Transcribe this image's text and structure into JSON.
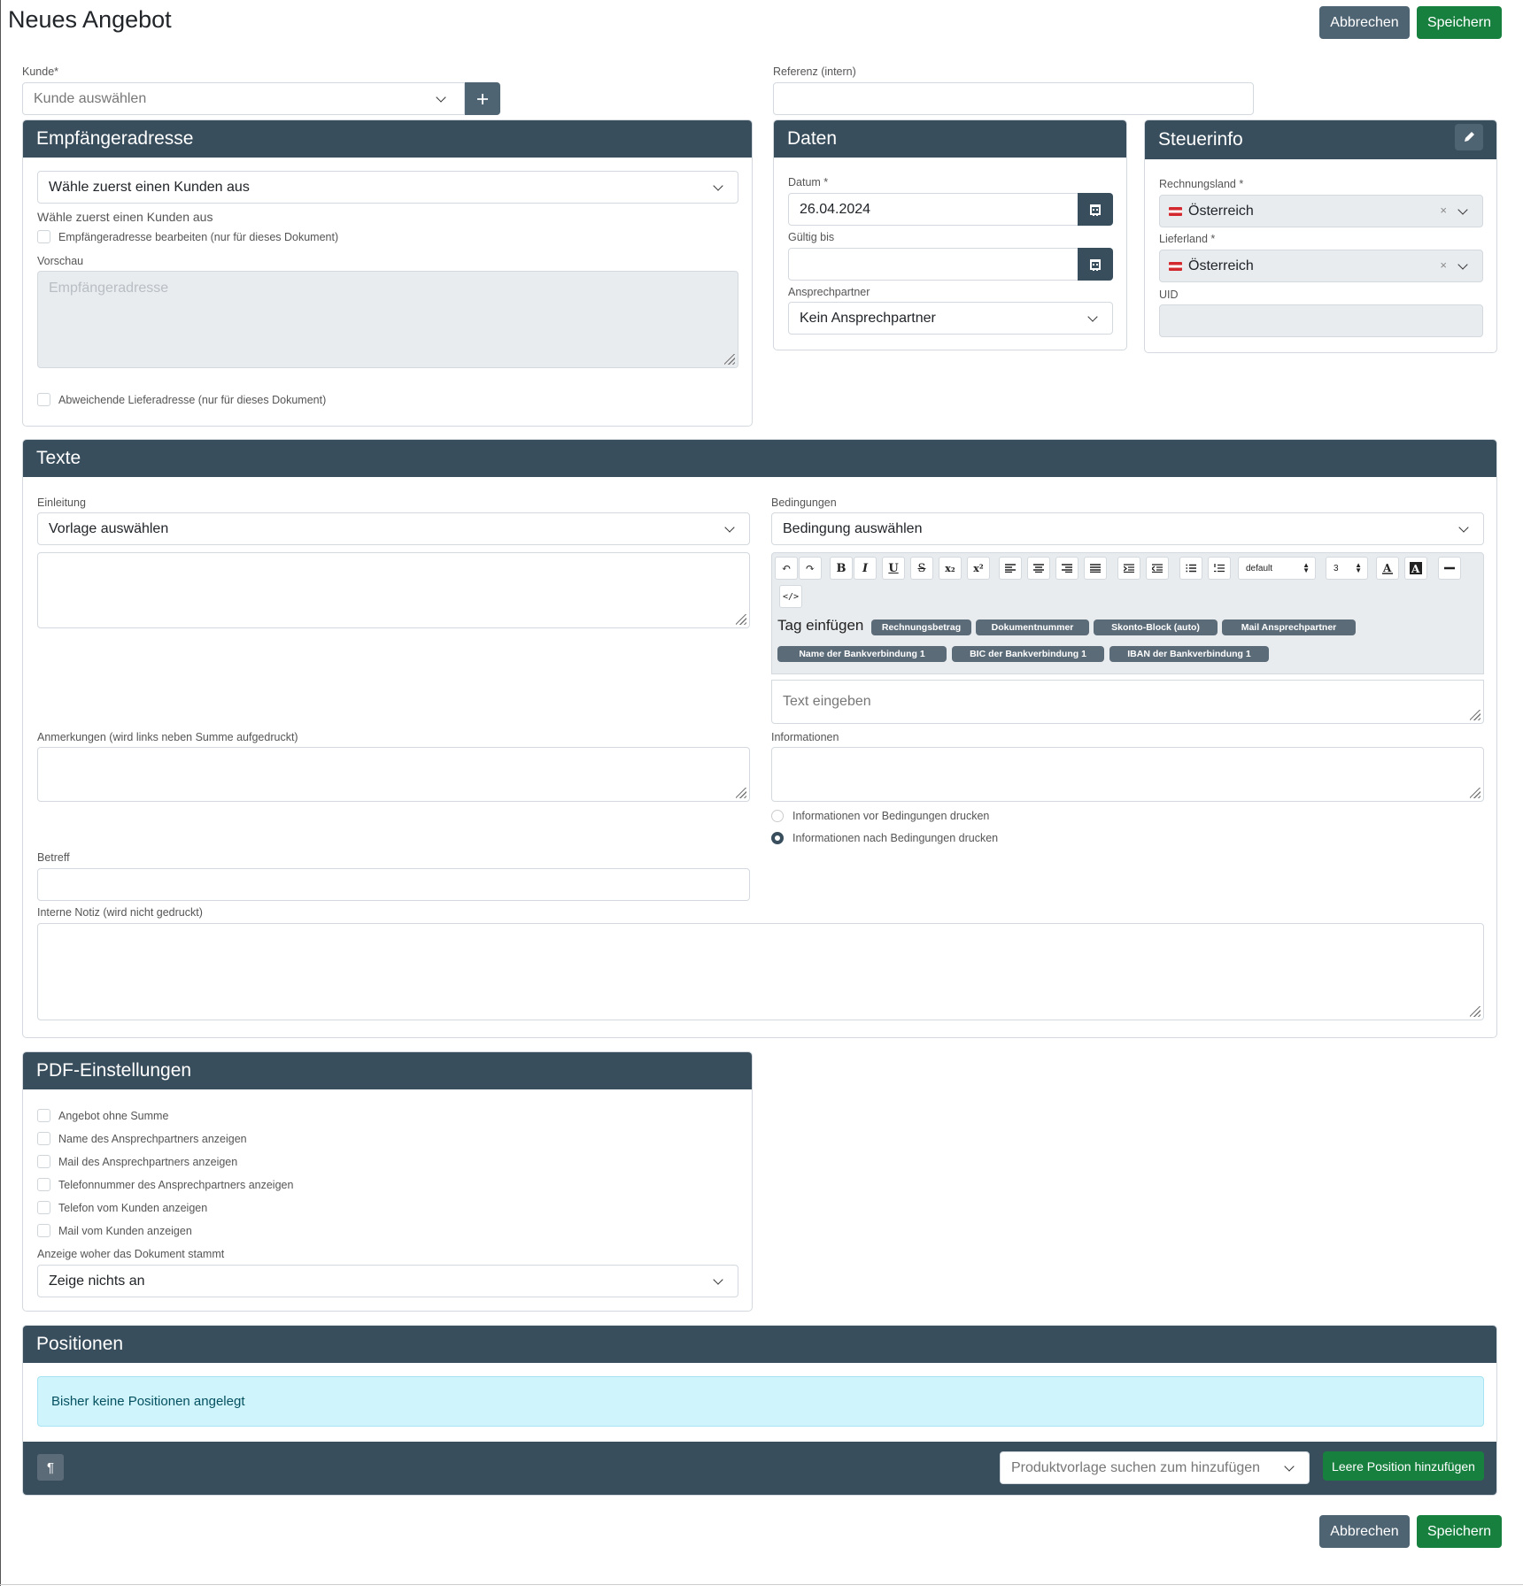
{
  "page": {
    "title": "Neues Angebot",
    "cancel_label": "Abbrechen",
    "save_label": "Speichern"
  },
  "kunde": {
    "label": "Kunde*",
    "placeholder": "Kunde auswählen",
    "add_icon": "plus-icon"
  },
  "referenz": {
    "label": "Referenz (intern)",
    "value": ""
  },
  "empfaenger": {
    "title": "Empfängeradresse",
    "select_value": "Wähle zuerst einen Kunden aus",
    "hint": "Wähle zuerst einen Kunden aus",
    "edit_checkbox_label": "Empfängeradresse bearbeiten (nur für dieses Dokument)",
    "preview_label": "Vorschau",
    "preview_placeholder": "Empfängeradresse",
    "alt_delivery_label": "Abweichende Lieferadresse (nur für dieses Dokument)"
  },
  "daten": {
    "title": "Daten",
    "datum_label": "Datum *",
    "datum_value": "26.04.2024",
    "gueltig_label": "Gültig bis",
    "gueltig_value": "",
    "ansprechpartner_label": "Ansprechpartner",
    "ansprechpartner_value": "Kein Ansprechpartner"
  },
  "steuerinfo": {
    "title": "Steuerinfo",
    "edit_icon": "pencil-icon",
    "rechnungsland_label": "Rechnungsland *",
    "rechnungsland_value": "Österreich",
    "lieferland_label": "Lieferland *",
    "lieferland_value": "Österreich",
    "clear_symbol": "×",
    "uid_label": "UID",
    "uid_value": ""
  },
  "texte": {
    "title": "Texte",
    "einleitung_label": "Einleitung",
    "einleitung_select": "Vorlage auswählen",
    "bedingungen_label": "Bedingungen",
    "bedingungen_select": "Bedingung auswählen",
    "toolbar": {
      "undo": "↶",
      "redo": "↷",
      "bold": "B",
      "italic": "I",
      "underline": "U",
      "strike": "S",
      "subscript": "x₂",
      "superscript": "x²",
      "font_select": "default",
      "size_select": "3",
      "code": "</>"
    },
    "tag_label": "Tag einfügen",
    "tags": [
      "Rechnungsbetrag",
      "Dokumentnummer",
      "Skonto-Block (auto)",
      "Mail Ansprechpartner",
      "Name der Bankverbindung 1",
      "BIC der Bankverbindung 1",
      "IBAN der Bankverbindung 1"
    ],
    "editor_placeholder": "Text eingeben",
    "anmerkungen_label": "Anmerkungen (wird links neben Summe aufgedruckt)",
    "informationen_label": "Informationen",
    "radio_before": "Informationen vor Bedingungen drucken",
    "radio_after": "Informationen nach Bedingungen drucken",
    "radio_selected": "after",
    "betreff_label": "Betreff",
    "notiz_label": "Interne Notiz (wird nicht gedruckt)"
  },
  "pdf": {
    "title": "PDF-Einstellungen",
    "options": [
      "Angebot ohne Summe",
      "Name des Ansprechpartners anzeigen",
      "Mail des Ansprechpartners anzeigen",
      "Telefonnummer des Ansprechpartners anzeigen",
      "Telefon vom Kunden anzeigen",
      "Mail vom Kunden anzeigen"
    ],
    "herkunft_label": "Anzeige woher das Dokument stammt",
    "herkunft_value": "Zeige nichts an"
  },
  "positionen": {
    "title": "Positionen",
    "empty_message": "Bisher keine Positionen angelegt",
    "pilcrow": "¶",
    "product_placeholder": "Produktvorlage suchen zum hinzufügen",
    "add_empty_label": "Leere Position hinzufügen"
  },
  "colors": {
    "header": "#394e5d",
    "primary_green": "#18803f",
    "secondary_grey": "#4f6473",
    "info_bg": "#cff4fc"
  }
}
